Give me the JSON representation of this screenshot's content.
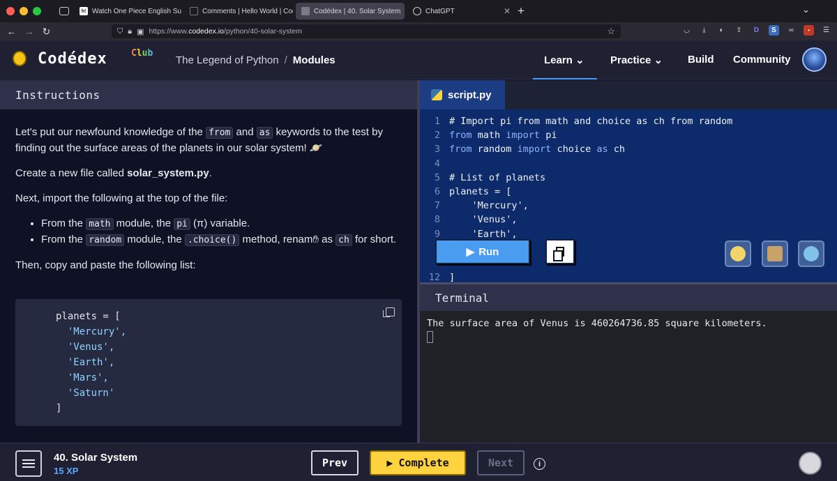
{
  "browser": {
    "tabs": [
      {
        "label": "Watch One Piece English Sub/D",
        "fav": "h!"
      },
      {
        "label": "Comments | Hello World | Codé",
        "fav": ""
      },
      {
        "label": "Codédex | 40. Solar System",
        "fav": ""
      },
      {
        "label": "ChatGPT",
        "fav": ""
      }
    ],
    "url_prefix": "https://www.",
    "url_host": "codedex.io",
    "url_path": "/python/40-solar-system"
  },
  "header": {
    "logo": "Codédex",
    "logo_badge": "Club",
    "breadcrumb": [
      "The Legend of Python",
      "/",
      "Modules"
    ],
    "nav": [
      "Learn",
      "Practice",
      "Build",
      "Community"
    ]
  },
  "instructions": {
    "title": "Instructions",
    "p1_a": "Let's put our newfound knowledge of the ",
    "p1_from": "from",
    "p1_b": " and ",
    "p1_as": "as",
    "p1_c": " keywords to the test by finding out the surface areas of the planets in our solar system! 🪐",
    "p2_a": "Create a new file called ",
    "p2_file": "solar_system.py",
    "p2_b": ".",
    "p3": "Next, import the following at the top of the file:",
    "b1_a": "From the ",
    "b1_math": "math",
    "b1_b": " module, the ",
    "b1_pi": "pi",
    "b1_c": " (π) variable.",
    "b2_a": "From the ",
    "b2_random": "random",
    "b2_b": " module, the ",
    "b2_choice": ".choice()",
    "b2_c": " method, renam",
    "b2_d": " as ",
    "b2_ch": "ch",
    "b2_e": " for short.",
    "p4": "Then, copy and paste the following list:",
    "code_lines": [
      "planets = [",
      "  'Mercury',",
      "  'Venus',",
      "  'Earth',",
      "  'Mars',",
      "  'Saturn'",
      "]"
    ]
  },
  "editor": {
    "filename": "script.py",
    "lines": [
      {
        "n": "1",
        "text": "# Import pi from math and choice as ch from random"
      },
      {
        "n": "2",
        "text": "from math import pi"
      },
      {
        "n": "3",
        "text": "from random import choice as ch"
      },
      {
        "n": "4",
        "text": ""
      },
      {
        "n": "5",
        "text": "# List of planets"
      },
      {
        "n": "6",
        "text": "planets = ["
      },
      {
        "n": "7",
        "text": "    'Mercury',"
      },
      {
        "n": "8",
        "text": "    'Venus',"
      },
      {
        "n": "9",
        "text": "    'Earth',"
      },
      {
        "n": "12",
        "text": "]"
      }
    ],
    "run_label": "Run"
  },
  "terminal": {
    "title": "Terminal",
    "output": "The surface area of Venus is 460264736.85 square kilometers."
  },
  "footer": {
    "lesson": "40. Solar System",
    "xp": "15 XP",
    "prev": "Prev",
    "complete": "Complete",
    "next": "Next",
    "info": "i"
  }
}
